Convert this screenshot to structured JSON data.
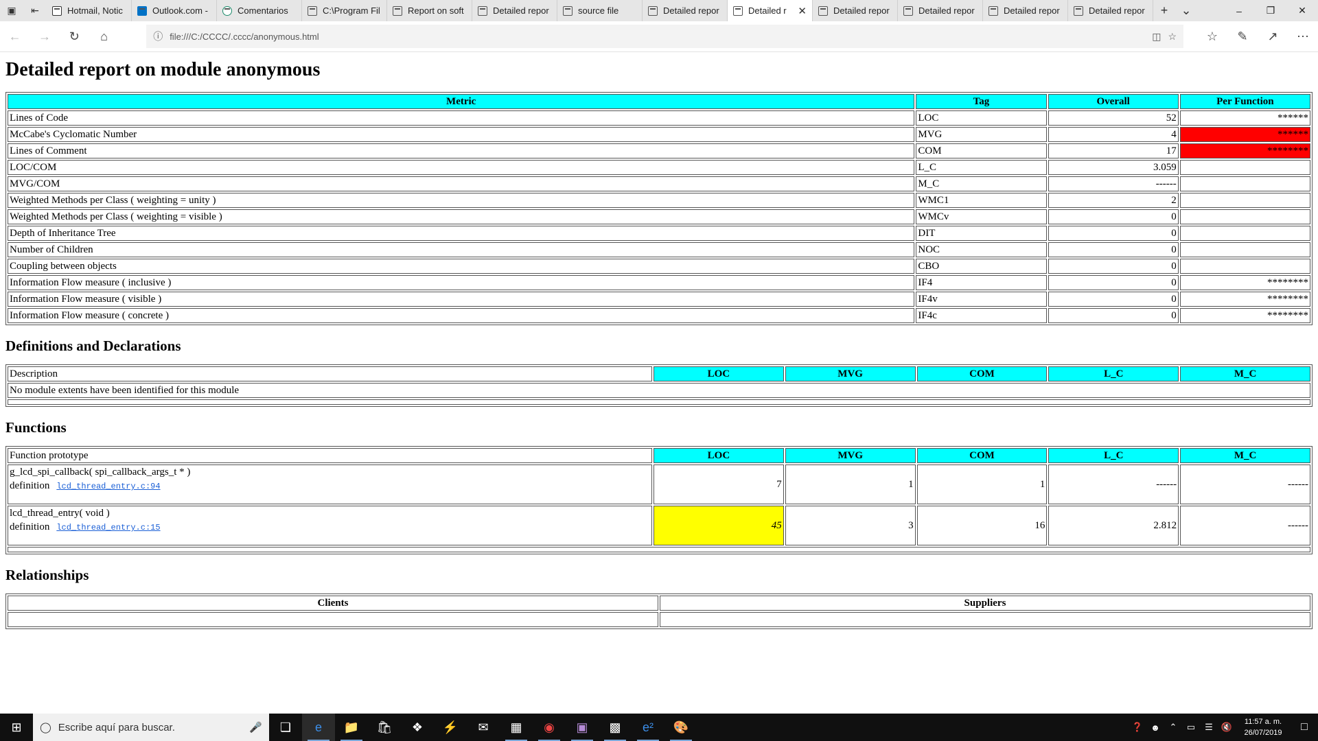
{
  "browser": {
    "tabs": [
      {
        "label": "Hotmail, Notic",
        "icon": "document-icon"
      },
      {
        "label": "Outlook.com -",
        "icon": "outlook-icon"
      },
      {
        "label": "Comentarios",
        "icon": "circle-icon"
      },
      {
        "label": "C:\\Program Fil",
        "icon": "page-icon"
      },
      {
        "label": "Report on soft",
        "icon": "page-icon"
      },
      {
        "label": "Detailed repor",
        "icon": "page-icon"
      },
      {
        "label": "source file",
        "icon": "page-icon"
      },
      {
        "label": "Detailed repor",
        "icon": "page-icon"
      },
      {
        "label": "Detailed r",
        "icon": "page-icon",
        "active": true
      },
      {
        "label": "Detailed repor",
        "icon": "page-icon"
      },
      {
        "label": "Detailed repor",
        "icon": "page-icon"
      },
      {
        "label": "Detailed repor",
        "icon": "page-icon"
      },
      {
        "label": "Detailed repor",
        "icon": "page-icon"
      }
    ],
    "url": "file:///C:/CCCC/.cccc/anonymous.html"
  },
  "page": {
    "title": "Detailed report on module anonymous",
    "summary": {
      "headers": [
        "Metric",
        "Tag",
        "Overall",
        "Per Function"
      ],
      "rows": [
        {
          "metric": "Lines of Code",
          "tag": "LOC",
          "overall": "52",
          "per_function": "******",
          "pf_red": false
        },
        {
          "metric": "McCabe's Cyclomatic Number",
          "tag": "MVG",
          "overall": "4",
          "per_function": "******",
          "pf_red": true
        },
        {
          "metric": "Lines of Comment",
          "tag": "COM",
          "overall": "17",
          "per_function": "********",
          "pf_red": true
        },
        {
          "metric": "LOC/COM",
          "tag": "L_C",
          "overall": "3.059",
          "per_function": "",
          "pf_red": false
        },
        {
          "metric": "MVG/COM",
          "tag": "M_C",
          "overall": "------",
          "per_function": "",
          "pf_red": false
        },
        {
          "metric": "Weighted Methods per Class (  weighting = unity )",
          "tag": "WMC1",
          "overall": "2",
          "per_function": "",
          "pf_red": false
        },
        {
          "metric": "Weighted Methods per Class (  weighting = visible )",
          "tag": "WMCv",
          "overall": "0",
          "per_function": "",
          "pf_red": false
        },
        {
          "metric": "Depth of Inheritance Tree",
          "tag": "DIT",
          "overall": "0",
          "per_function": "",
          "pf_red": false
        },
        {
          "metric": "Number of Children",
          "tag": "NOC",
          "overall": "0",
          "per_function": "",
          "pf_red": false
        },
        {
          "metric": "Coupling between objects",
          "tag": "CBO",
          "overall": "0",
          "per_function": "",
          "pf_red": false
        },
        {
          "metric": "Information Flow measure (  inclusive )",
          "tag": "IF4",
          "overall": "0",
          "per_function": "********",
          "pf_red": false
        },
        {
          "metric": "Information Flow measure (  visible )",
          "tag": "IF4v",
          "overall": "0",
          "per_function": "********",
          "pf_red": false
        },
        {
          "metric": "Information Flow measure (  concrete )",
          "tag": "IF4c",
          "overall": "0",
          "per_function": "********",
          "pf_red": false
        }
      ]
    },
    "definitions": {
      "heading": "Definitions and Declarations",
      "headers": [
        "Description",
        "LOC",
        "MVG",
        "COM",
        "L_C",
        "M_C"
      ],
      "message": "No module extents have been identified for this module"
    },
    "functions": {
      "heading": "Functions",
      "headers": [
        "Function prototype",
        "LOC",
        "MVG",
        "COM",
        "L_C",
        "M_C"
      ],
      "def_label": "definition",
      "rows": [
        {
          "prototype": "g_lcd_spi_callback(  spi_callback_args_t * )",
          "link": "lcd_thread_entry.c:94",
          "loc": "7",
          "mvg": "1",
          "com": "1",
          "l_c": "------",
          "m_c": "------",
          "loc_yellow": false
        },
        {
          "prototype": "lcd_thread_entry(  void )",
          "link": "lcd_thread_entry.c:15",
          "loc": "45",
          "mvg": "3",
          "com": "16",
          "l_c": "2.812",
          "m_c": "------",
          "loc_yellow": true
        }
      ]
    },
    "relationships": {
      "heading": "Relationships",
      "clients": "Clients",
      "suppliers": "Suppliers"
    }
  },
  "taskbar": {
    "search_placeholder": "Escribe aquí para buscar.",
    "time": "11:57 a. m.",
    "date": "26/07/2019"
  },
  "colors": {
    "header_cyan": "#00ffff",
    "alert_red": "#ff0000",
    "warn_yellow": "#ffff00",
    "link_blue": "#1a5fd6"
  }
}
